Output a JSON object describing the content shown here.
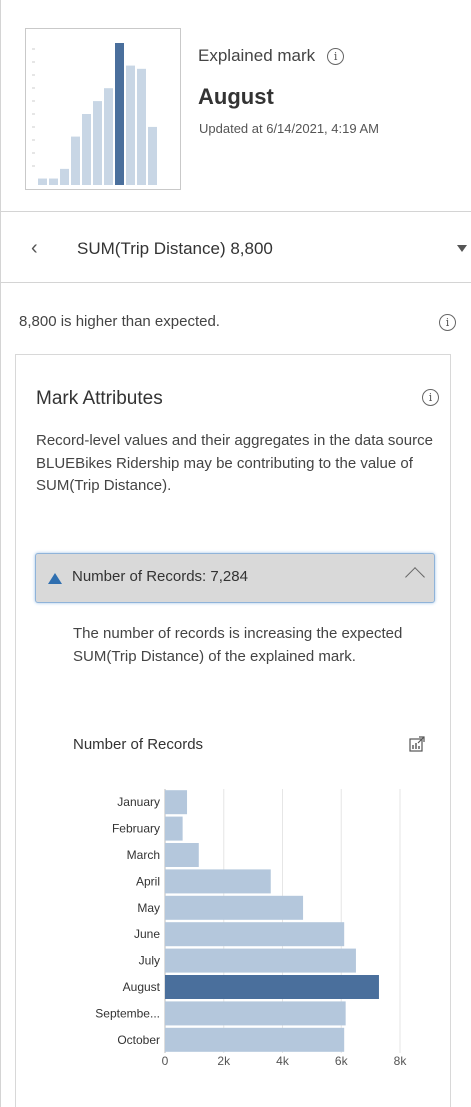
{
  "header": {
    "explained_label": "Explained mark",
    "mark_title": "August",
    "updated": "Updated at 6/14/2021, 4:19 AM",
    "thumbnail_values": [
      2,
      2,
      5,
      15,
      22,
      26,
      30,
      44,
      37,
      36,
      18
    ]
  },
  "measure": {
    "text": "SUM(Trip Distance)  8,800"
  },
  "summary": {
    "text": "8,800 is higher than expected."
  },
  "card": {
    "title": "Mark Attributes",
    "description": "Record-level values and their aggregates in the data source BLUEBikes Ridership may be contributing to the value of SUM(Trip Distance).",
    "record_label": "Number of Records: 7,284",
    "record_description": "The number of records is increasing the expected SUM(Trip Distance) of the explained mark.",
    "chart_title": "Number of Records"
  },
  "colors": {
    "highlight": "#4a6f9c",
    "bar": "#b4c7dc",
    "accent": "#2f6fb0"
  },
  "chart_data": {
    "type": "bar",
    "orientation": "horizontal",
    "title": "Number of Records",
    "categories": [
      "January",
      "February",
      "March",
      "April",
      "May",
      "June",
      "July",
      "August",
      "Septembe...",
      "October"
    ],
    "values": [
      750,
      600,
      1150,
      3600,
      4700,
      6100,
      6500,
      7284,
      6150,
      6100
    ],
    "highlight": "August",
    "xticks": [
      "0",
      "2k",
      "4k",
      "6k",
      "8k"
    ],
    "xlim": [
      0,
      8000
    ],
    "grid": true
  }
}
